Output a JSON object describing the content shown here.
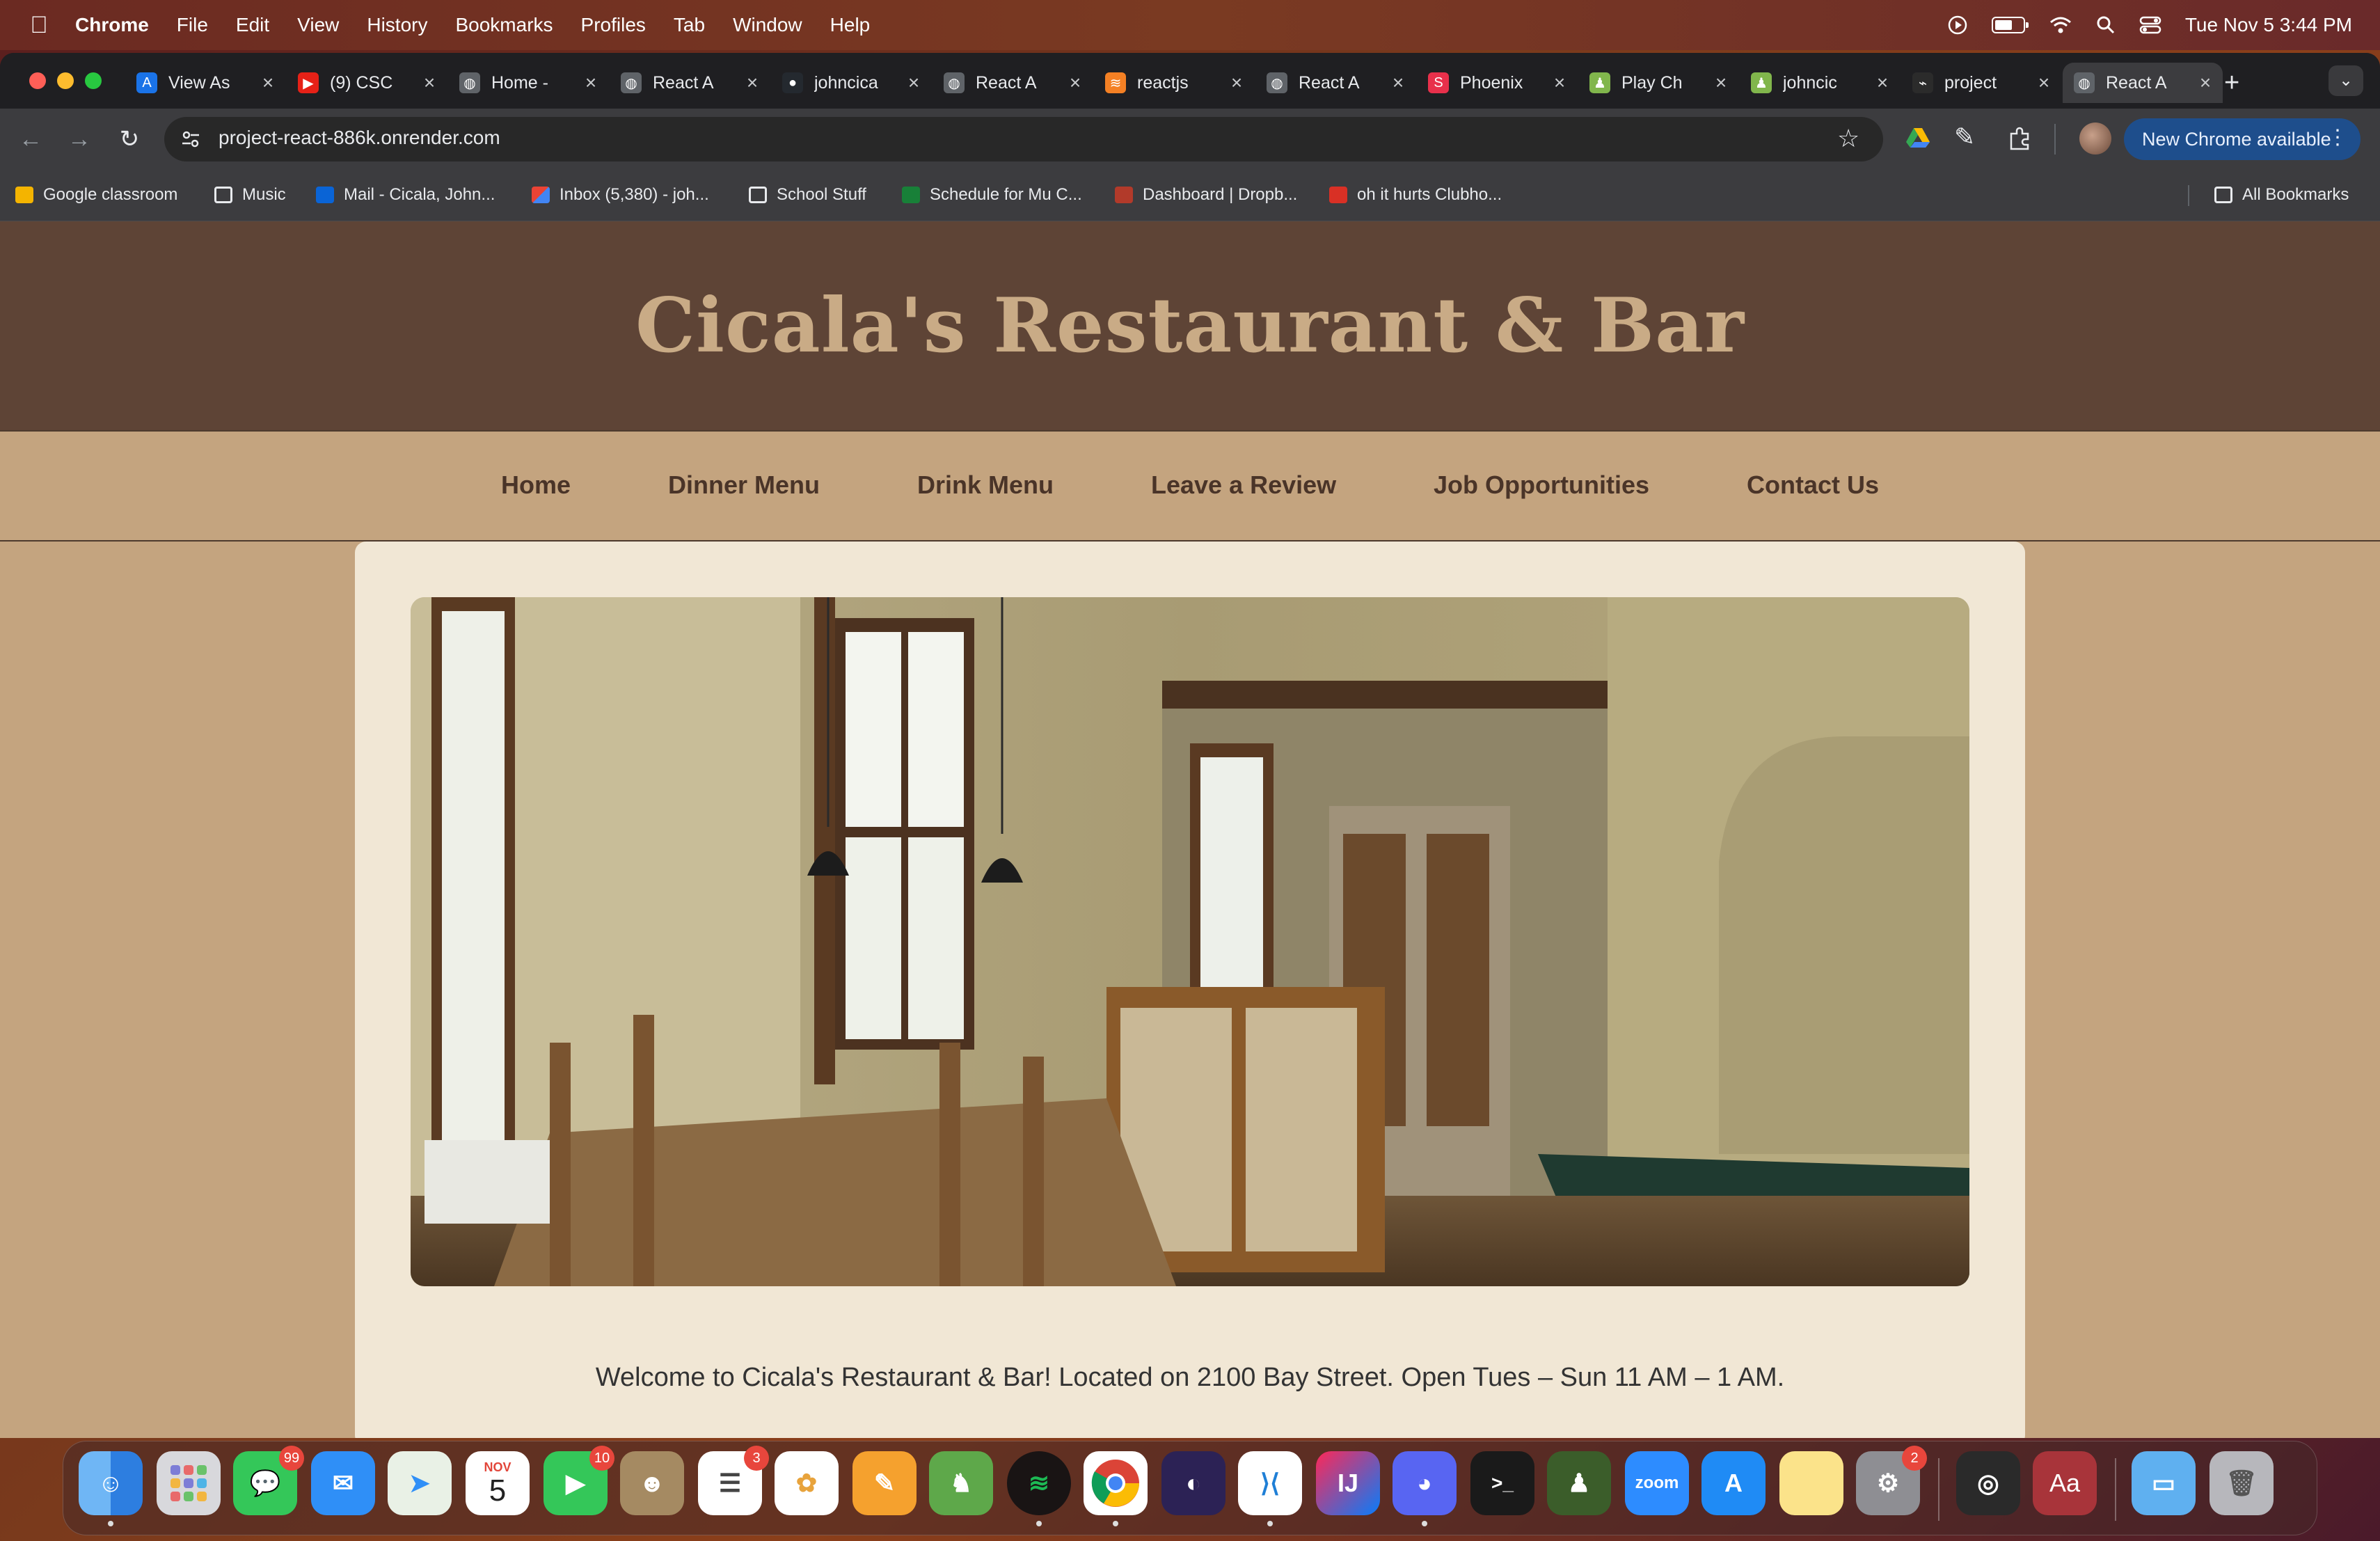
{
  "menubar": {
    "app": "Chrome",
    "items": [
      "File",
      "Edit",
      "View",
      "History",
      "Bookmarks",
      "Profiles",
      "Tab",
      "Window",
      "Help"
    ],
    "datetime": "Tue Nov 5  3:44 PM"
  },
  "tabs": [
    {
      "title": "View As",
      "favicon": "A",
      "color": "#1a73e8"
    },
    {
      "title": "(9) CSC",
      "favicon": "▶",
      "color": "#e62117"
    },
    {
      "title": "Home -",
      "favicon": "◍",
      "color": "#5f6368"
    },
    {
      "title": "React A",
      "favicon": "◍",
      "color": "#5f6368"
    },
    {
      "title": "johncica",
      "favicon": "●",
      "color": "#24292f"
    },
    {
      "title": "React A",
      "favicon": "◍",
      "color": "#5f6368"
    },
    {
      "title": "reactjs",
      "favicon": "≋",
      "color": "#f48024"
    },
    {
      "title": "React A",
      "favicon": "◍",
      "color": "#5f6368"
    },
    {
      "title": "Phoenix",
      "favicon": "S",
      "color": "#e8304b"
    },
    {
      "title": "Play Ch",
      "favicon": "♟",
      "color": "#81b64c"
    },
    {
      "title": "johncic",
      "favicon": "♟",
      "color": "#81b64c"
    },
    {
      "title": "project",
      "favicon": "⌁",
      "color": "#2b2b2b"
    },
    {
      "title": "React A",
      "favicon": "◍",
      "color": "#5f6368",
      "active": true
    }
  ],
  "toolbar": {
    "url": "project-react-886k.onrender.com",
    "new_chrome": "New Chrome available"
  },
  "bookmarks": [
    {
      "label": "Google classroom"
    },
    {
      "label": "Music"
    },
    {
      "label": "Mail - Cicala, John..."
    },
    {
      "label": "Inbox (5,380) - joh..."
    },
    {
      "label": "School Stuff"
    },
    {
      "label": "Schedule for Mu C..."
    },
    {
      "label": "Dashboard | Dropb..."
    },
    {
      "label": "oh it hurts Clubho..."
    }
  ],
  "all_bookmarks": "All Bookmarks",
  "site": {
    "title": "Cicala's Restaurant & Bar",
    "nav": [
      "Home",
      "Dinner Menu",
      "Drink Menu",
      "Leave a Review",
      "Job Opportunities",
      "Contact Us"
    ],
    "welcome": "Welcome to Cicala's Restaurant & Bar! Located on 2100 Bay Street. Open Tues – Sun 11 AM – 1 AM."
  },
  "dock": {
    "messages_badge": "99",
    "calendar_month": "NOV",
    "calendar_day": "5",
    "facetime_badge": "10",
    "reminders_badge": "3",
    "zoom_label": "zoom",
    "settings_badge": "2",
    "dictionary_label": "Aa"
  },
  "colors": {
    "header_bg": "#5e4436",
    "title_color": "#c9ab86",
    "nav_bg": "#c4a47f",
    "card_bg": "#f1e7d5"
  }
}
